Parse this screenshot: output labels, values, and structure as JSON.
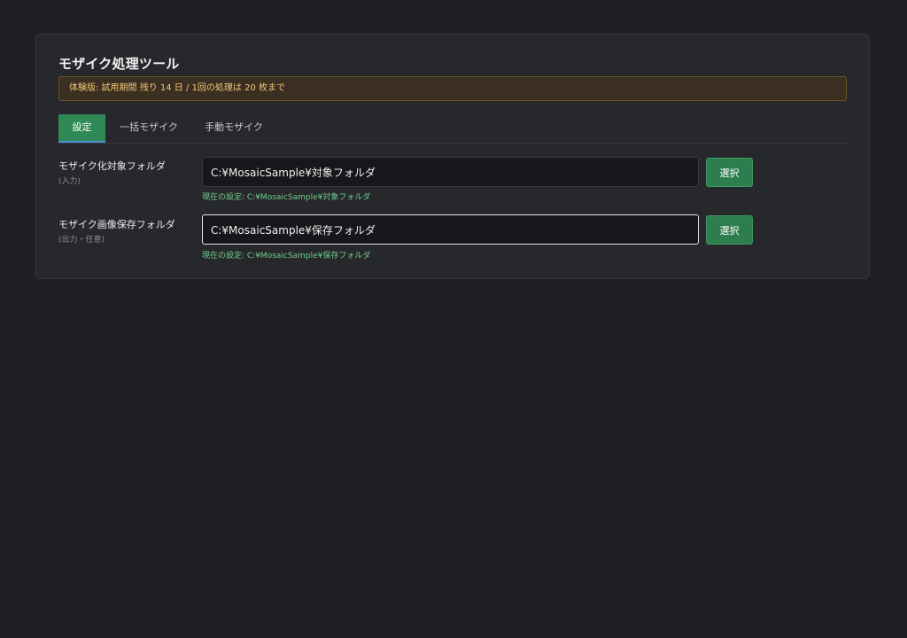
{
  "app": {
    "title": "モザイク処理ツール"
  },
  "banner": {
    "text": "体験版: 試用期間 残り 14 日 / 1回の処理は 20 枚まで"
  },
  "tabs": [
    {
      "label": "設定",
      "active": true
    },
    {
      "label": "一括モザイク",
      "active": false
    },
    {
      "label": "手動モザイク",
      "active": false
    }
  ],
  "settings": {
    "input_folder": {
      "label": "モザイク化対象フォルダ",
      "sublabel": "(入力)",
      "value": "C:¥MosaicSample¥対象フォルダ",
      "button_label": "選択",
      "current": "現在の設定: C:¥MosaicSample¥対象フォルダ"
    },
    "output_folder": {
      "label": "モザイク画像保存フォルダ",
      "sublabel": "(出力・任意)",
      "value": "C:¥MosaicSample¥保存フォルダ",
      "button_label": "選択",
      "current": "現在の設定: C:¥MosaicSample¥保存フォルダ"
    }
  },
  "colors": {
    "background": "#1f2024",
    "panel": "#27282c",
    "accent_green": "#2e7d4f",
    "banner_bg": "#3a2f21",
    "banner_text": "#f0c778",
    "current_text": "#6fcf8a"
  }
}
